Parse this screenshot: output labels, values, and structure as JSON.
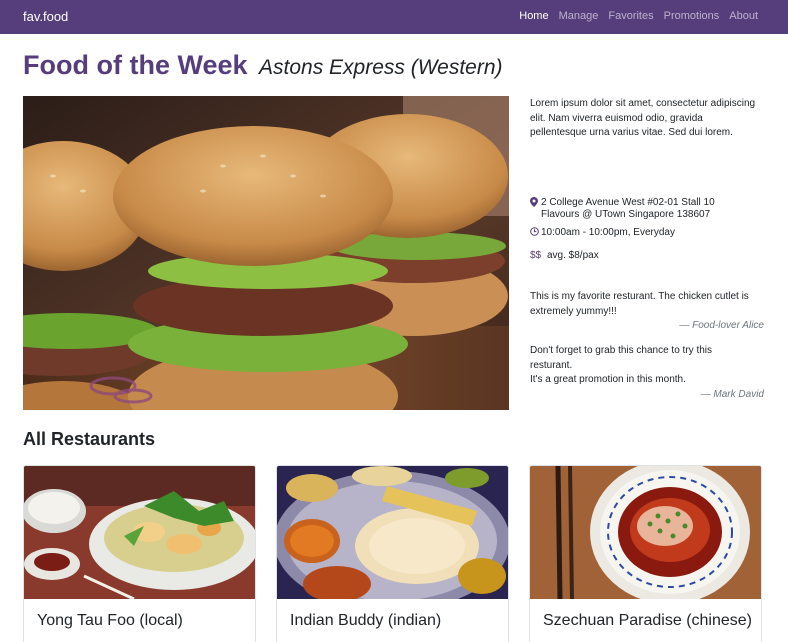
{
  "navbar": {
    "brand": "fav.food",
    "links": [
      {
        "label": "Home",
        "active": true
      },
      {
        "label": "Manage",
        "active": false
      },
      {
        "label": "Favorites",
        "active": false
      },
      {
        "label": "Promotions",
        "active": false
      },
      {
        "label": "About",
        "active": false
      }
    ]
  },
  "featured": {
    "title": "Food of the Week",
    "restaurant": "Astons Express (Western)",
    "description": "Lorem ipsum dolor sit amet, consectetur adipiscing elit. Nam viverra euismod odio, gravida pellentesque urna varius vitae. Sed dui lorem.",
    "address_line1": "2 College Avenue West #02-01 Stall 10",
    "address_line2": "Flavours @ UTown Singapore 138607",
    "hours": "10:00am - 10:00pm, Everyday",
    "price_icon": "$$",
    "price": "avg. $8/pax",
    "reviews": [
      {
        "text_line1": "This is my favorite resturant. The chicken cutlet is",
        "text_line2": "extremely yummy!!!",
        "text_line3": "",
        "author": "— Food-lover Alice"
      },
      {
        "text_line1": "Don't forget to grab this chance to try this",
        "text_line2": "resturant.",
        "text_line3": "It's a great promotion in this month.",
        "author": "— Mark David"
      }
    ]
  },
  "restaurants": {
    "title": "All Restaurants",
    "items": [
      {
        "name": "Yong Tau Foo (local)"
      },
      {
        "name": "Indian Buddy (indian)"
      },
      {
        "name": "Szechuan Paradise (chinese)"
      }
    ]
  },
  "colors": {
    "brand": "#563d7c",
    "muted": "#6c757d"
  },
  "icons": {
    "location": "map-marker-icon",
    "hours": "clock-icon",
    "price": "dollar-icon"
  }
}
